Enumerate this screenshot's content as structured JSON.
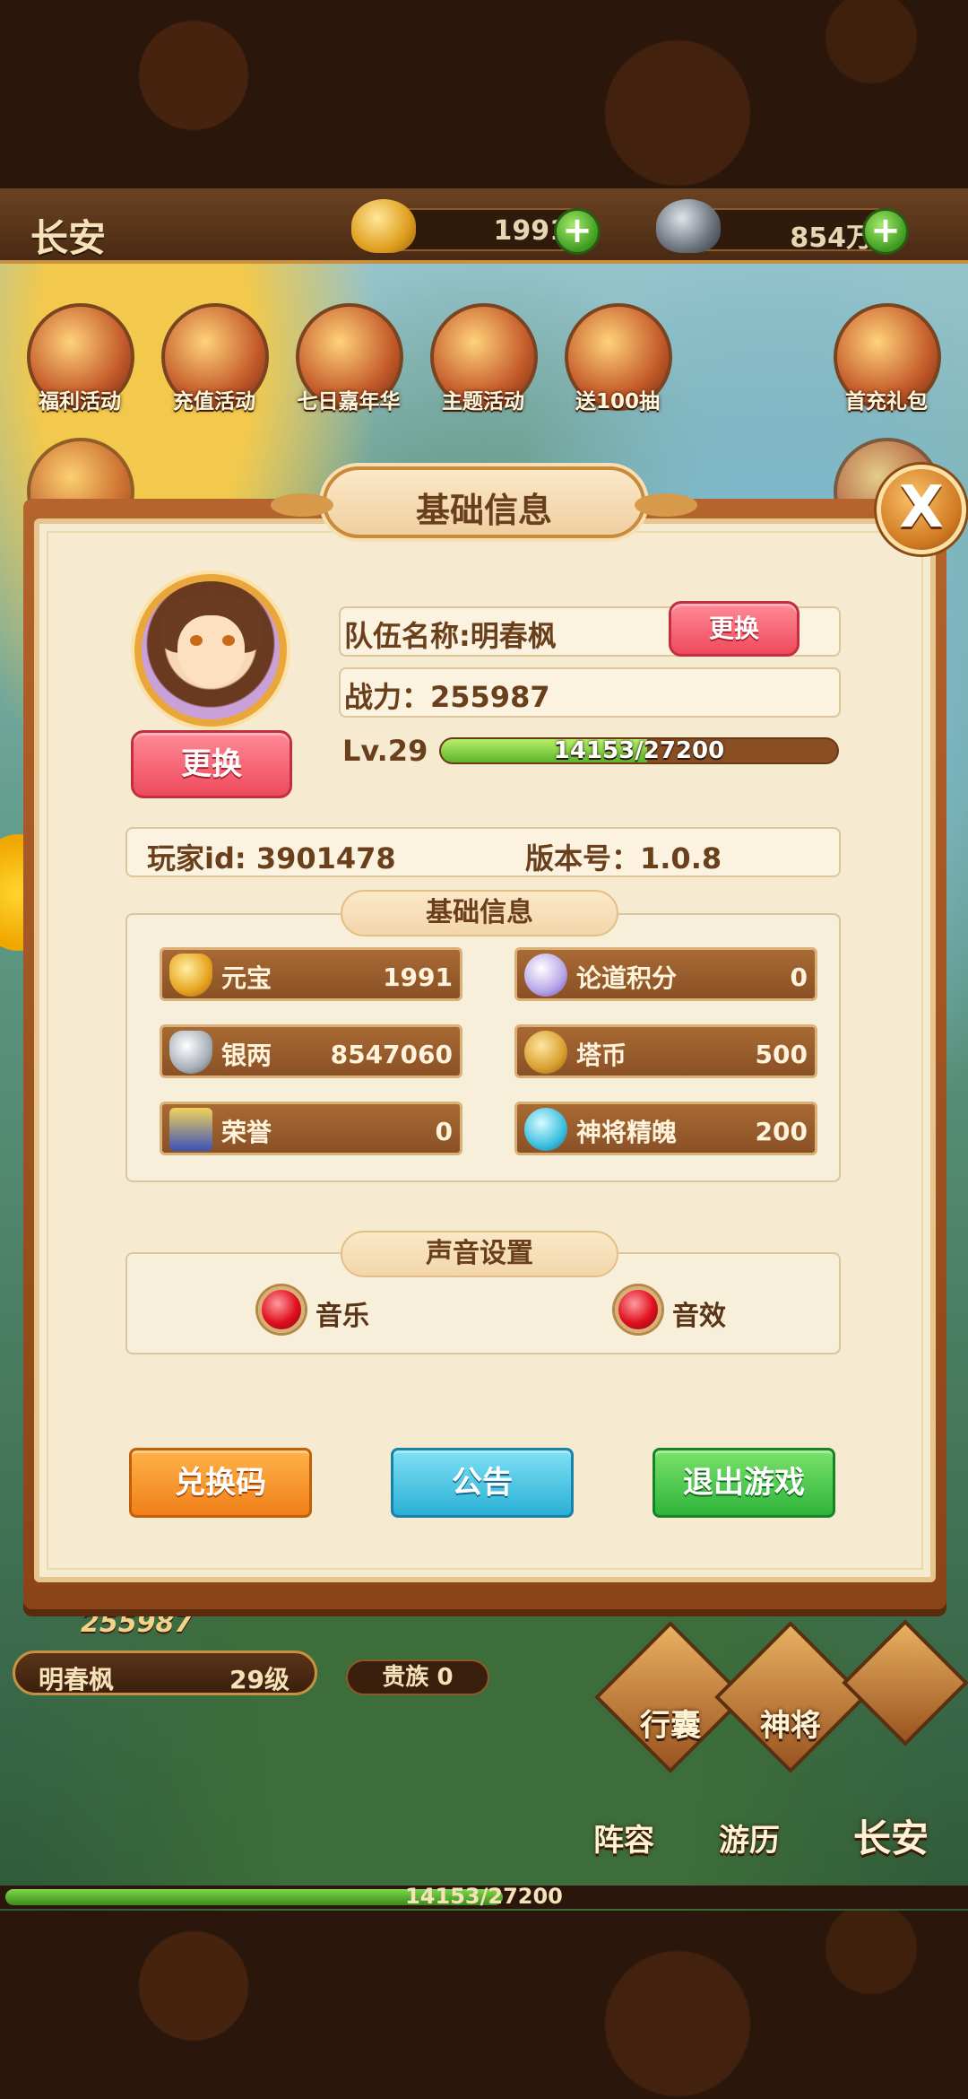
{
  "topbar": {
    "city": "长安",
    "gold": "1991",
    "silver": "854万"
  },
  "activities": [
    {
      "label": "福利活动"
    },
    {
      "label": "充值活动"
    },
    {
      "label": "七日嘉年华"
    },
    {
      "label": "主题活动"
    },
    {
      "label": "送100抽"
    },
    {
      "label": "首充礼包"
    }
  ],
  "hud": {
    "power": "255987",
    "name": "明春枫",
    "level": "29级",
    "noble": "贵族 0",
    "exp": "14153/27200",
    "exp_fraction": 0.52,
    "buttons": {
      "bag": "行囊",
      "generals": "神将",
      "lineup": "阵容",
      "travel": "游历",
      "city": "长安"
    }
  },
  "dialog": {
    "title": "基础信息",
    "close": "X",
    "change_avatar": "更换",
    "team_name": "队伍名称:明春枫",
    "change_team": "更换",
    "power": "战力：255987",
    "level": "Lv.29",
    "exp": "14153/27200",
    "exp_fraction": 0.52,
    "player_id": "玩家id: 3901478",
    "version": "版本号：1.0.8",
    "basic_section_title": "基础信息",
    "resources": [
      {
        "name": "元宝",
        "value": "1991",
        "icon": "gold-ingot-icon"
      },
      {
        "name": "论道积分",
        "value": "0",
        "icon": "dao-points-icon"
      },
      {
        "name": "银两",
        "value": "8547060",
        "icon": "silver-ingot-icon"
      },
      {
        "name": "塔币",
        "value": "500",
        "icon": "tower-coin-icon"
      },
      {
        "name": "荣誉",
        "value": "0",
        "icon": "honor-icon"
      },
      {
        "name": "神将精魄",
        "value": "200",
        "icon": "general-soul-icon"
      }
    ],
    "sound_section_title": "声音设置",
    "music_label": "音乐",
    "sfx_label": "音效",
    "redeem_button": "兑换码",
    "notice_button": "公告",
    "exit_button": "退出游戏"
  }
}
